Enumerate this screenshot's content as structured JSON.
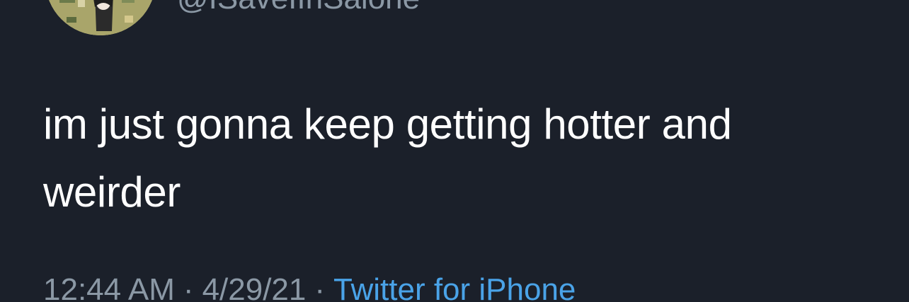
{
  "tweet": {
    "handle": "@ISaveIInSalone",
    "text": "im just gonna keep getting hotter and weirder",
    "time": "12:44 AM",
    "date": "4/29/21",
    "separator": "·",
    "source": "Twitter for iPhone"
  },
  "colors": {
    "background": "#1b202a",
    "text": "#ffffff",
    "secondary": "#8b98a5",
    "link": "#4aa3e8"
  }
}
